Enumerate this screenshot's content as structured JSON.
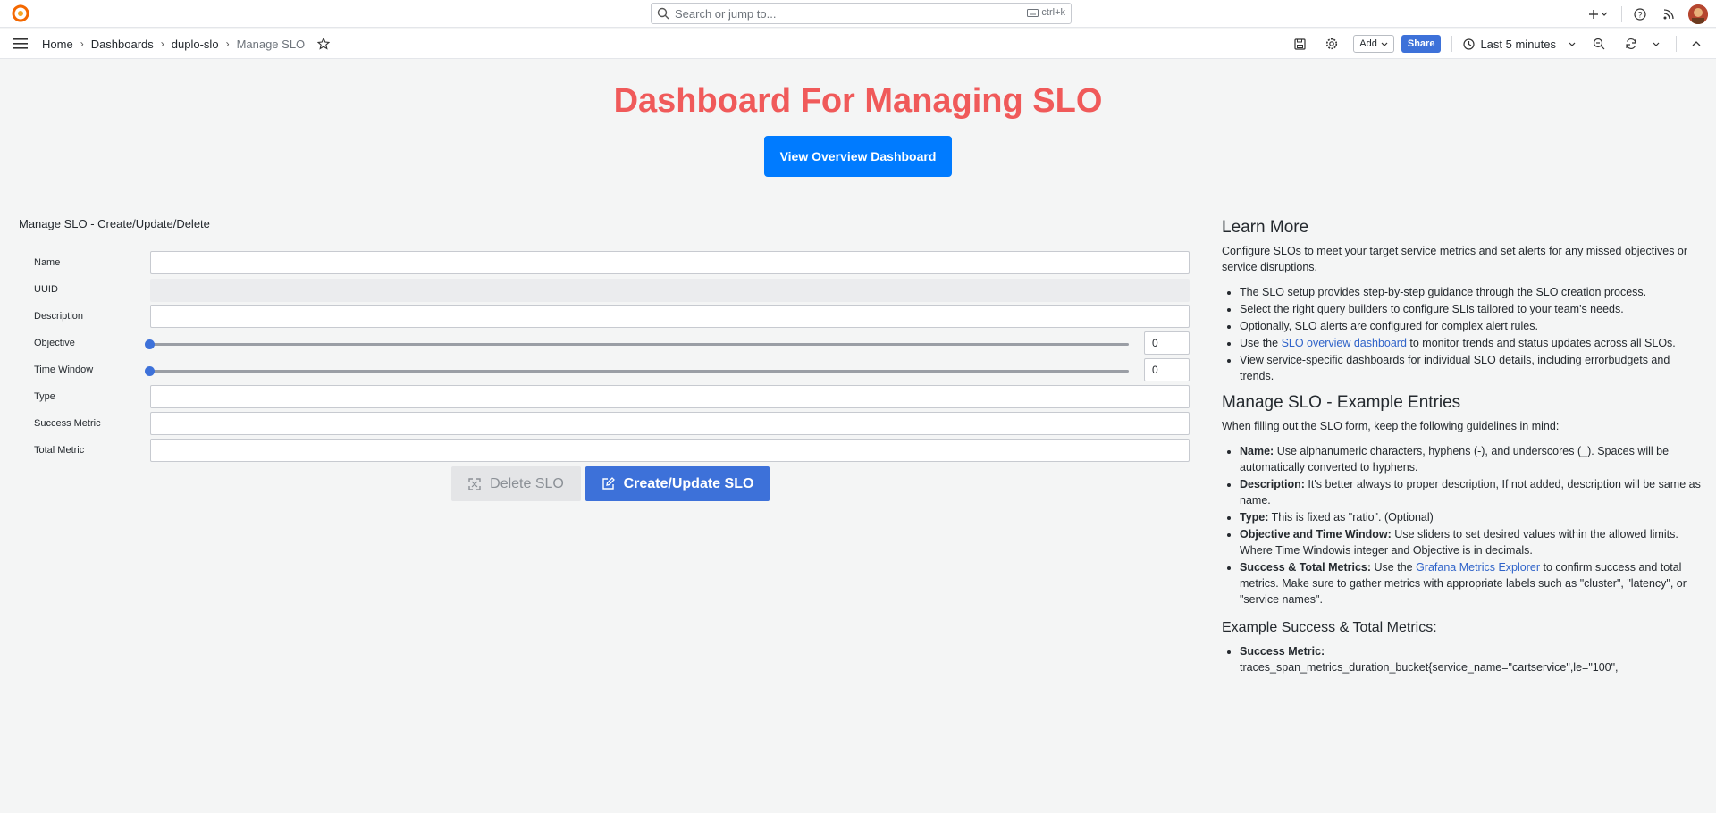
{
  "topbar": {
    "search_placeholder": "Search or jump to...",
    "search_shortcut": "ctrl+k"
  },
  "breadcrumbs": [
    "Home",
    "Dashboards",
    "duplo-slo",
    "Manage SLO"
  ],
  "toolbar": {
    "add_label": "Add",
    "share_label": "Share",
    "time_range": "Last 5 minutes"
  },
  "header": {
    "title": "Dashboard For Managing SLO",
    "overview_button": "View Overview Dashboard"
  },
  "form": {
    "title": "Manage SLO - Create/Update/Delete",
    "labels": {
      "name": "Name",
      "uuid": "UUID",
      "description": "Description",
      "objective": "Objective",
      "time_window": "Time Window",
      "type": "Type",
      "success_metric": "Success Metric",
      "total_metric": "Total Metric"
    },
    "objective_value": "0",
    "time_window_value": "0",
    "objective_level": 0,
    "time_window_level": 0,
    "delete_button": "Delete SLO",
    "create_button": "Create/Update SLO"
  },
  "info": {
    "learn_more_title": "Learn More",
    "learn_more_intro": "Configure SLOs to meet your target service metrics and set alerts for any missed objectives or service disruptions.",
    "learn_items": {
      "i1": "The SLO setup provides step-by-step guidance through the SLO creation process.",
      "i2": "Select the right query builders to configure SLIs tailored to your team's needs.",
      "i3": "Optionally, SLO alerts are configured for complex alert rules.",
      "i4_pre": "Use the ",
      "i4_link": "SLO overview dashboard",
      "i4_post": " to monitor trends and status updates across all SLOs.",
      "i5": "View service-specific dashboards for individual SLO details, including errorbudgets and trends."
    },
    "examples_title": "Manage SLO - Example Entries",
    "examples_intro": "When filling out the SLO form, keep the following guidelines in mind:",
    "examples": {
      "name_key": "Name:",
      "name_text": " Use alphanumeric characters, hyphens (-), and underscores (_). Spaces will be automatically converted to hyphens.",
      "desc_key": "Description:",
      "desc_text": " It's better always to proper description, If not added, description will be same as name.",
      "type_key": "Type:",
      "type_text": " This is fixed as \"ratio\". (Optional)",
      "obj_key": "Objective and Time Window:",
      "obj_text": " Use sliders to set desired values within the allowed limits. Where Time Windowis integer and Objective is in decimals.",
      "metrics_key": "Success & Total Metrics:",
      "metrics_pre": " Use the ",
      "metrics_link": "Grafana Metrics Explorer",
      "metrics_post": " to confirm success and total metrics. Make sure to gather metrics with appropriate labels such as \"cluster\", \"latency\", or \"service names\"."
    },
    "metrics_title": "Example Success & Total Metrics:",
    "success_key": "Success Metric:",
    "success_text": "traces_span_metrics_duration_bucket{service_name=\"cartservice\",le=\"100\","
  }
}
